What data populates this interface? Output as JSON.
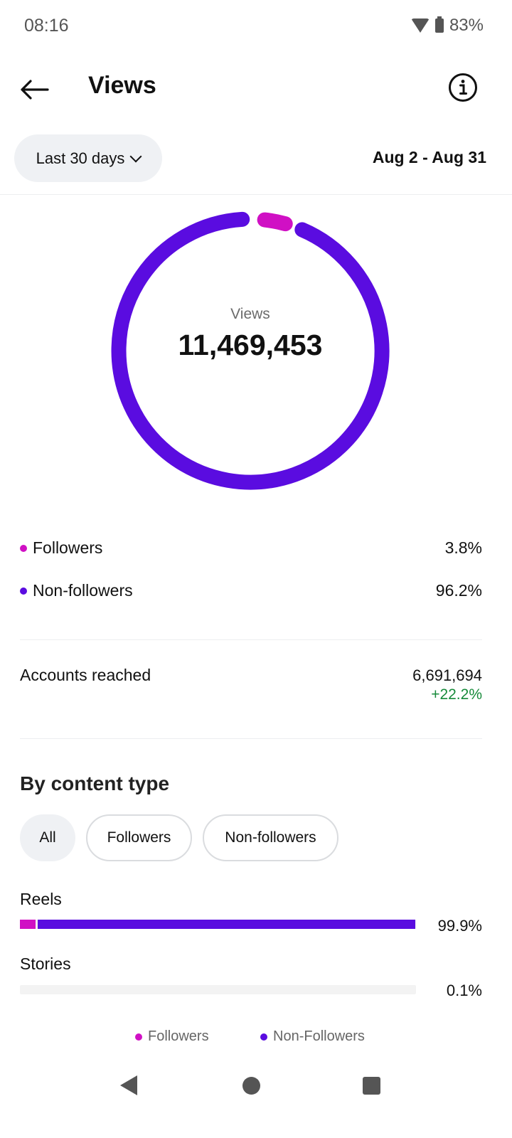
{
  "status_bar": {
    "time": "08:16",
    "battery": "83%"
  },
  "header": {
    "title": "Views"
  },
  "filter": {
    "range_label": "Last 30 days",
    "date_range": "Aug 2 - Aug 31"
  },
  "donut": {
    "label": "Views",
    "value": "11,469,453"
  },
  "colors": {
    "followers": "#d010c4",
    "non_followers": "#5a0ce0",
    "positive": "#168a3a"
  },
  "audience": [
    {
      "label": "Followers",
      "value": "3.8%",
      "fraction": 0.038
    },
    {
      "label": "Non-followers",
      "value": "96.2%",
      "fraction": 0.962
    }
  ],
  "accounts_reached": {
    "label": "Accounts reached",
    "value": "6,691,694",
    "change": "+22.2%"
  },
  "content_type": {
    "title": "By content type",
    "tabs": [
      "All",
      "Followers",
      "Non-followers"
    ],
    "bars": [
      {
        "label": "Reels",
        "value": "99.9%",
        "followers_fraction": 0.04,
        "non_followers_fraction": 0.96,
        "total_fraction": 0.999
      },
      {
        "label": "Stories",
        "value": "0.1%",
        "followers_fraction": 0.0,
        "non_followers_fraction": 0.0,
        "total_fraction": 0.001
      }
    ],
    "legend": [
      "Followers",
      "Non-Followers"
    ]
  }
}
